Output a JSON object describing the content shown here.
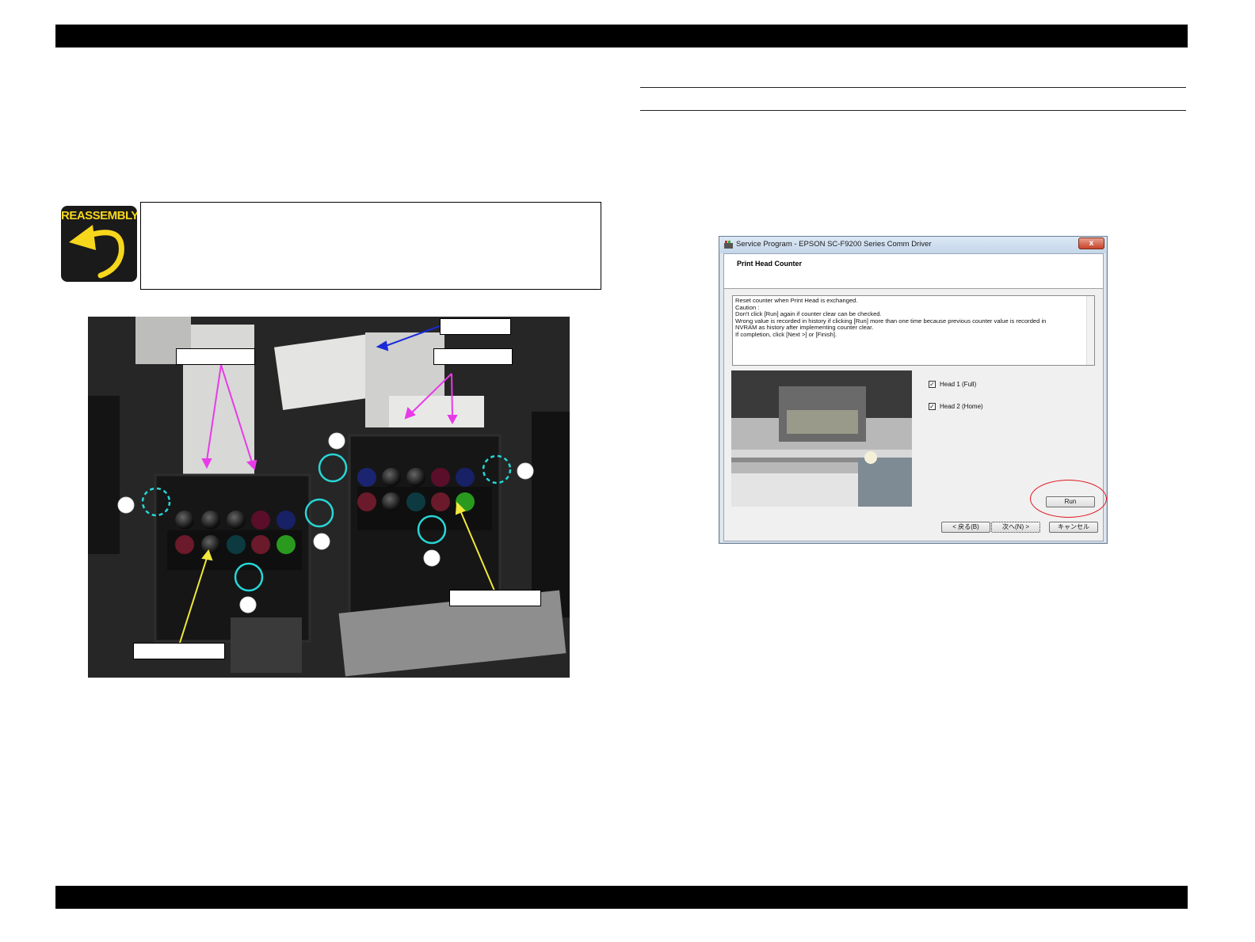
{
  "reassembly_icon": {
    "label": "REASSEMBLY",
    "color": "#f7d71c"
  },
  "dialog": {
    "title": "Service Program - EPSON SC-F9200 Series Comm Driver",
    "close_glyph": "x",
    "heading": "Print Head Counter",
    "text_lines": [
      "Reset counter when Print Head is exchanged.",
      "",
      "Caution :",
      "Don't click [Run] again if counter clear can be checked.",
      "Wrong value is recorded in history if clicking [Run] more than one time because previous counter value is recorded in",
      "NVRAM as history after implementing counter clear.",
      "If completion, click [Next >] or [Finish]."
    ],
    "checkboxes": [
      {
        "label": "Head 1 (Full)",
        "checked_glyph": "✓"
      },
      {
        "label": "Head 2 (Home)",
        "checked_glyph": "✓"
      }
    ],
    "run_label": "Run",
    "back_label": "< 戻る(B)",
    "next_label": "次へ(N) >",
    "cancel_label": "キャンセル"
  },
  "colors": {
    "highlight_cyan": "#28d6d6",
    "arrow_magenta": "#e83ae8",
    "arrow_yellow": "#f0e83a",
    "arrow_blue": "#1a2ad8",
    "run_circle": "#e0141e"
  }
}
